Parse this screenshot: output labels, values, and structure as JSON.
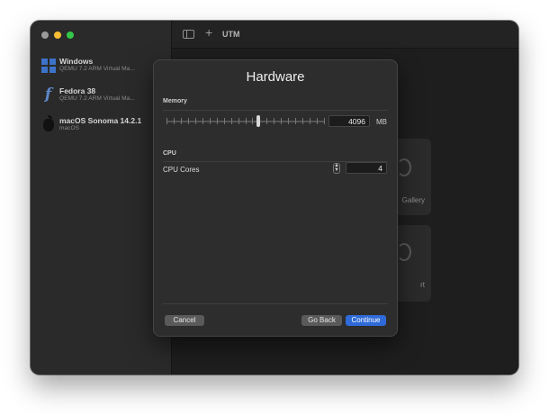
{
  "window": {
    "toolbar": {
      "title": "UTM",
      "sidebar_icon": "sidebar-toggle-icon",
      "add_icon": "plus-icon"
    }
  },
  "sidebar": {
    "items": [
      {
        "name": "Windows",
        "subtitle": "QEMU 7.2 ARM Virtual Ma...",
        "icon": "windows-logo"
      },
      {
        "name": "Fedora 38",
        "subtitle": "QEMU 7.2 ARM Virtual Ma...",
        "icon": "fedora-logo"
      },
      {
        "name": "macOS Sonoma 14.2.1",
        "subtitle": "macOS",
        "icon": "apple-logo"
      }
    ]
  },
  "background": {
    "tile_gallery_label": "Gallery",
    "tile_import_label": "rt"
  },
  "dialog": {
    "title": "Hardware",
    "memory": {
      "section_label": "Memory",
      "value": "4096",
      "unit": "MB",
      "slider_fraction": 0.58
    },
    "cpu": {
      "section_label": "CPU",
      "cores_label": "CPU Cores",
      "cores_value": "4",
      "stepper_up": "▲",
      "stepper_down": "▼"
    },
    "buttons": {
      "cancel": "Cancel",
      "back": "Go Back",
      "continue": "Continue"
    }
  },
  "colors": {
    "accent": "#2f6bd8",
    "traffic_close": "#9a9a9a",
    "traffic_min": "#f6bd34",
    "traffic_max": "#33c748"
  }
}
